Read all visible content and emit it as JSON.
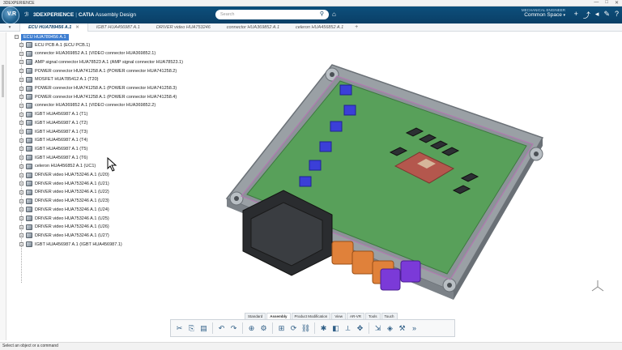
{
  "window": {
    "title": "3DEXPERIENCE"
  },
  "header": {
    "brand_3d": "3DEXPERIENCE",
    "brand_app": "CATIA",
    "brand_module": "Assembly Design",
    "compass_label": "V.R",
    "search_placeholder": "Search",
    "space_owner": "MECHANICAL ENGINEER",
    "space_name": "Common Space"
  },
  "tabs": [
    {
      "label": "ECU HUA789456 A.1",
      "active": true
    },
    {
      "label": "IGBT HUA456987 A.1",
      "active": false
    },
    {
      "label": "DRIVER video HUA753246",
      "active": false
    },
    {
      "label": "connector HUA369852 A.1",
      "active": false
    },
    {
      "label": "celeron HUA456852 A.1",
      "active": false
    }
  ],
  "tree": {
    "root": "ECU HUA789456 A.1",
    "items": [
      "ECU PCB A.1 (ECU PCB.1)",
      "connector HUA369852 A.1 (VIDEO connector HUA369852.1)",
      "AMP signal connector HUA78523 A.1 (AMP signal connector HUA78523.1)",
      "POWER connector HUA741258 A.1 (POWER connector HUA741258.2)",
      "MOSFET HUA785412 A.1 (T20)",
      "POWER connector HUA741258 A.1 (POWER connector HUA741258.3)",
      "POWER connector HUA741258 A.1 (POWER connector HUA741258.4)",
      "connector HUA369852 A.1 (VIDEO connector HUA369852.2)",
      "IGBT HUA456987 A.1 (T1)",
      "IGBT HUA456987 A.1 (T2)",
      "IGBT HUA456987 A.1 (T3)",
      "IGBT HUA456987 A.1 (T4)",
      "IGBT HUA456987 A.1 (T5)",
      "IGBT HUA456987 A.1 (T6)",
      "celeron HUA456852 A.1 (UC1)",
      "DRIVER video HUA753246 A.1 (U20)",
      "DRIVER video HUA753246 A.1 (U21)",
      "DRIVER video HUA753246 A.1 (U22)",
      "DRIVER video HUA753246 A.1 (U23)",
      "DRIVER video HUA753246 A.1 (U24)",
      "DRIVER video HUA753246 A.1 (U25)",
      "DRIVER video HUA753246 A.1 (U26)",
      "DRIVER video HUA753246 A.1 (U27)",
      "IGBT HUA456987 A.1 (IGBT HUA456987.1)"
    ]
  },
  "command_tabs": [
    "Standard",
    "Assembly",
    "Product Modification",
    "View",
    "AR-VR",
    "Tools",
    "Touch"
  ],
  "status": {
    "message": "Select an object or a command"
  },
  "icons": {
    "toolbar": [
      "cut-icon",
      "copy-icon",
      "paste-icon",
      "undo-icon",
      "redo-icon",
      "zoom-icon",
      "fit-all-icon",
      "insert-icon",
      "replace-icon",
      "constraint-icon",
      "explode-icon",
      "section-icon",
      "measure-icon",
      "compass-icon",
      "publish-icon",
      "render-icon",
      "settings-icon"
    ]
  }
}
